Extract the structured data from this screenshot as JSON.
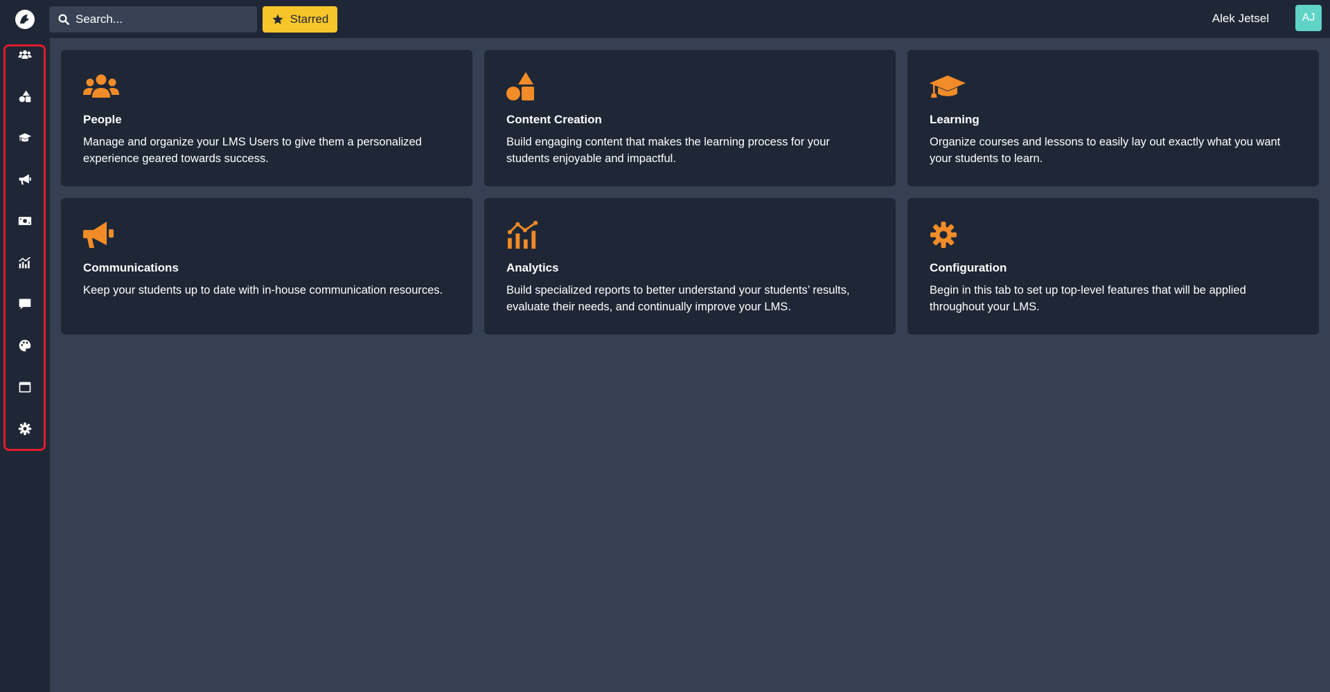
{
  "header": {
    "search_placeholder": "Search...",
    "starred_label": "Starred",
    "user_name": "Alek Jetsel",
    "user_initials": "AJ"
  },
  "sidebar": {
    "items": [
      {
        "icon": "users-icon"
      },
      {
        "icon": "shapes-icon"
      },
      {
        "icon": "graduation-cap-icon"
      },
      {
        "icon": "megaphone-icon"
      },
      {
        "icon": "money-bill-icon"
      },
      {
        "icon": "chart-icon"
      },
      {
        "icon": "comment-icon"
      },
      {
        "icon": "palette-icon"
      },
      {
        "icon": "window-icon"
      },
      {
        "icon": "gear-icon"
      }
    ]
  },
  "cards": [
    {
      "title": "People",
      "description": "Manage and organize your LMS Users to give them a personalized experience geared towards success.",
      "icon": "users-icon"
    },
    {
      "title": "Content Creation",
      "description": "Build engaging content that makes the learning process for your students enjoyable and impactful.",
      "icon": "shapes-icon"
    },
    {
      "title": "Learning",
      "description": "Organize courses and lessons to easily lay out exactly what you want your students to learn.",
      "icon": "graduation-cap-icon"
    },
    {
      "title": "Communications",
      "description": "Keep your students up to date with in-house communication resources.",
      "icon": "megaphone-icon"
    },
    {
      "title": "Analytics",
      "description": "Build specialized reports to better understand your students’ results, evaluate their needs, and continually improve your LMS.",
      "icon": "chart-icon"
    },
    {
      "title": "Configuration",
      "description": "Begin in this tab to set up top-level features that will be applied throughout your LMS.",
      "icon": "gear-icon"
    }
  ],
  "colors": {
    "accent": "#f28c28",
    "starred": "#f7c52a",
    "avatar": "#5fd3c6",
    "highlight": "#e11a2b",
    "panel": "#1f2736",
    "background": "#364052"
  }
}
